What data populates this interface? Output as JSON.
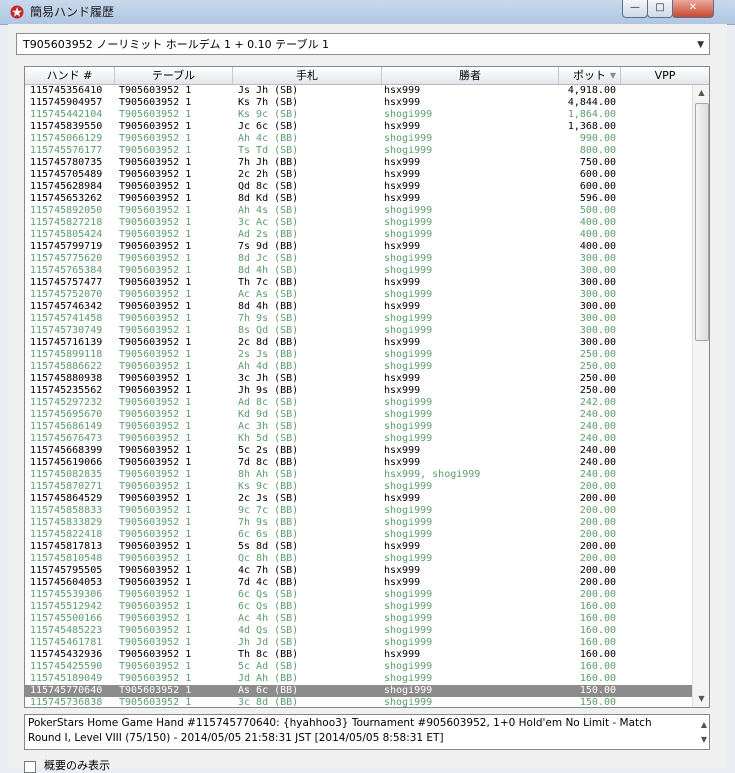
{
  "window": {
    "title": "簡易ハンド履歴"
  },
  "dropdown": {
    "value": "T905603952 ノーリミット ホールデム 1 + 0.10 テーブル 1"
  },
  "columns": [
    "ハンド #",
    "テーブル",
    "手札",
    "勝者",
    "ポット",
    "VPP"
  ],
  "rows": [
    {
      "hand": "115745356410",
      "table": "T905603952 1",
      "cards": "Js Jh (SB)",
      "winner": "hsx999",
      "pot": "4,918.00",
      "style": "black"
    },
    {
      "hand": "115745904957",
      "table": "T905603952 1",
      "cards": "Ks 7h (SB)",
      "winner": "hsx999",
      "pot": "4,844.00",
      "style": "black"
    },
    {
      "hand": "115745442104",
      "table": "T905603952 1",
      "cards": "Ks 9c (SB)",
      "winner": "shogi999",
      "pot": "1,864.00",
      "style": "green"
    },
    {
      "hand": "115745839550",
      "table": "T905603952 1",
      "cards": "Jc 6c (SB)",
      "winner": "hsx999",
      "pot": "1,368.00",
      "style": "black"
    },
    {
      "hand": "115745066129",
      "table": "T905603952 1",
      "cards": "Ah 4c (BB)",
      "winner": "shogi999",
      "pot": "990.00",
      "style": "green"
    },
    {
      "hand": "115745576177",
      "table": "T905603952 1",
      "cards": "Ts Td (SB)",
      "winner": "shogi999",
      "pot": "800.00",
      "style": "green"
    },
    {
      "hand": "115745780735",
      "table": "T905603952 1",
      "cards": "7h Jh (BB)",
      "winner": "hsx999",
      "pot": "750.00",
      "style": "black"
    },
    {
      "hand": "115745705489",
      "table": "T905603952 1",
      "cards": "2c 2h (SB)",
      "winner": "hsx999",
      "pot": "600.00",
      "style": "black"
    },
    {
      "hand": "115745628984",
      "table": "T905603952 1",
      "cards": "Qd 8c (SB)",
      "winner": "hsx999",
      "pot": "600.00",
      "style": "black"
    },
    {
      "hand": "115745653262",
      "table": "T905603952 1",
      "cards": "8d Kd (SB)",
      "winner": "hsx999",
      "pot": "596.00",
      "style": "black"
    },
    {
      "hand": "115745892050",
      "table": "T905603952 1",
      "cards": "Ah 4s (SB)",
      "winner": "shogi999",
      "pot": "500.00",
      "style": "green"
    },
    {
      "hand": "115745827218",
      "table": "T905603952 1",
      "cards": "3c Ac (SB)",
      "winner": "shogi999",
      "pot": "400.00",
      "style": "green"
    },
    {
      "hand": "115745805424",
      "table": "T905603952 1",
      "cards": "Ad 2s (BB)",
      "winner": "shogi999",
      "pot": "400.00",
      "style": "green"
    },
    {
      "hand": "115745799719",
      "table": "T905603952 1",
      "cards": "7s 9d (BB)",
      "winner": "hsx999",
      "pot": "400.00",
      "style": "black"
    },
    {
      "hand": "115745775620",
      "table": "T905603952 1",
      "cards": "8d Jc (SB)",
      "winner": "shogi999",
      "pot": "300.00",
      "style": "green"
    },
    {
      "hand": "115745765384",
      "table": "T905603952 1",
      "cards": "8d 4h (SB)",
      "winner": "shogi999",
      "pot": "300.00",
      "style": "green"
    },
    {
      "hand": "115745757477",
      "table": "T905603952 1",
      "cards": "Th 7c (BB)",
      "winner": "hsx999",
      "pot": "300.00",
      "style": "black"
    },
    {
      "hand": "115745752070",
      "table": "T905603952 1",
      "cards": "Ac As (SB)",
      "winner": "shogi999",
      "pot": "300.00",
      "style": "green"
    },
    {
      "hand": "115745746342",
      "table": "T905603952 1",
      "cards": "8d 4h (BB)",
      "winner": "hsx999",
      "pot": "300.00",
      "style": "black"
    },
    {
      "hand": "115745741458",
      "table": "T905603952 1",
      "cards": "7h 9s (SB)",
      "winner": "shogi999",
      "pot": "300.00",
      "style": "green"
    },
    {
      "hand": "115745730749",
      "table": "T905603952 1",
      "cards": "8s Qd (SB)",
      "winner": "shogi999",
      "pot": "300.00",
      "style": "green"
    },
    {
      "hand": "115745716139",
      "table": "T905603952 1",
      "cards": "2c 8d (BB)",
      "winner": "hsx999",
      "pot": "300.00",
      "style": "black"
    },
    {
      "hand": "115745899118",
      "table": "T905603952 1",
      "cards": "2s Js (BB)",
      "winner": "shogi999",
      "pot": "250.00",
      "style": "green"
    },
    {
      "hand": "115745886622",
      "table": "T905603952 1",
      "cards": "Ah 4d (BB)",
      "winner": "shogi999",
      "pot": "250.00",
      "style": "green"
    },
    {
      "hand": "115745880938",
      "table": "T905603952 1",
      "cards": "3c Jh (SB)",
      "winner": "hsx999",
      "pot": "250.00",
      "style": "black"
    },
    {
      "hand": "115745235562",
      "table": "T905603952 1",
      "cards": "Jh 9s (BB)",
      "winner": "hsx999",
      "pot": "250.00",
      "style": "black"
    },
    {
      "hand": "115745297232",
      "table": "T905603952 1",
      "cards": "Ad 8c (SB)",
      "winner": "shogi999",
      "pot": "242.00",
      "style": "green"
    },
    {
      "hand": "115745695670",
      "table": "T905603952 1",
      "cards": "Kd 9d (SB)",
      "winner": "shogi999",
      "pot": "240.00",
      "style": "green"
    },
    {
      "hand": "115745686149",
      "table": "T905603952 1",
      "cards": "Ac 3h (SB)",
      "winner": "shogi999",
      "pot": "240.00",
      "style": "green"
    },
    {
      "hand": "115745676473",
      "table": "T905603952 1",
      "cards": "Kh 5d (SB)",
      "winner": "shogi999",
      "pot": "240.00",
      "style": "green"
    },
    {
      "hand": "115745668399",
      "table": "T905603952 1",
      "cards": "5c 2s (BB)",
      "winner": "hsx999",
      "pot": "240.00",
      "style": "black"
    },
    {
      "hand": "115745619066",
      "table": "T905603952 1",
      "cards": "7d 8c (BB)",
      "winner": "hsx999",
      "pot": "240.00",
      "style": "black"
    },
    {
      "hand": "115745082835",
      "table": "T905603952 1",
      "cards": "8h Ah (SB)",
      "winner": "hsx999, shogi999",
      "pot": "240.00",
      "style": "green"
    },
    {
      "hand": "115745870271",
      "table": "T905603952 1",
      "cards": "Ks 9c (BB)",
      "winner": "shogi999",
      "pot": "200.00",
      "style": "green"
    },
    {
      "hand": "115745864529",
      "table": "T905603952 1",
      "cards": "2c Js (SB)",
      "winner": "hsx999",
      "pot": "200.00",
      "style": "black"
    },
    {
      "hand": "115745858833",
      "table": "T905603952 1",
      "cards": "9c 7c (BB)",
      "winner": "shogi999",
      "pot": "200.00",
      "style": "green"
    },
    {
      "hand": "115745833829",
      "table": "T905603952 1",
      "cards": "7h 9s (BB)",
      "winner": "shogi999",
      "pot": "200.00",
      "style": "green"
    },
    {
      "hand": "115745822418",
      "table": "T905603952 1",
      "cards": "6c 6s (BB)",
      "winner": "shogi999",
      "pot": "200.00",
      "style": "green"
    },
    {
      "hand": "115745817813",
      "table": "T905603952 1",
      "cards": "5s 8d (SB)",
      "winner": "hsx999",
      "pot": "200.00",
      "style": "black"
    },
    {
      "hand": "115745810548",
      "table": "T905603952 1",
      "cards": "Qc 8h (BB)",
      "winner": "shogi999",
      "pot": "200.00",
      "style": "green"
    },
    {
      "hand": "115745795505",
      "table": "T905603952 1",
      "cards": "4c 7h (SB)",
      "winner": "hsx999",
      "pot": "200.00",
      "style": "black"
    },
    {
      "hand": "115745604053",
      "table": "T905603952 1",
      "cards": "7d 4c (BB)",
      "winner": "hsx999",
      "pot": "200.00",
      "style": "black"
    },
    {
      "hand": "115745539306",
      "table": "T905603952 1",
      "cards": "6c Qs (SB)",
      "winner": "shogi999",
      "pot": "200.00",
      "style": "green"
    },
    {
      "hand": "115745512942",
      "table": "T905603952 1",
      "cards": "6c Qs (BB)",
      "winner": "shogi999",
      "pot": "160.00",
      "style": "green"
    },
    {
      "hand": "115745500166",
      "table": "T905603952 1",
      "cards": "Ac 4h (SB)",
      "winner": "shogi999",
      "pot": "160.00",
      "style": "green"
    },
    {
      "hand": "115745485223",
      "table": "T905603952 1",
      "cards": "4d Qs (SB)",
      "winner": "shogi999",
      "pot": "160.00",
      "style": "green"
    },
    {
      "hand": "115745461781",
      "table": "T905603952 1",
      "cards": "Jh Jd (SB)",
      "winner": "shogi999",
      "pot": "160.00",
      "style": "green"
    },
    {
      "hand": "115745432936",
      "table": "T905603952 1",
      "cards": "Th 8c (BB)",
      "winner": "hsx999",
      "pot": "160.00",
      "style": "black"
    },
    {
      "hand": "115745425590",
      "table": "T905603952 1",
      "cards": "5c Ad (SB)",
      "winner": "shogi999",
      "pot": "160.00",
      "style": "green"
    },
    {
      "hand": "115745189049",
      "table": "T905603952 1",
      "cards": "Jd Ah (BB)",
      "winner": "shogi999",
      "pot": "160.00",
      "style": "green"
    },
    {
      "hand": "115745770640",
      "table": "T905603952 1",
      "cards": "As 6c (BB)",
      "winner": "shogi999",
      "pot": "150.00",
      "style": "selected"
    },
    {
      "hand": "115745736838",
      "table": "T905603952 1",
      "cards": "3c 8d (BB)",
      "winner": "shogi999",
      "pot": "150.00",
      "style": "green"
    }
  ],
  "detail": {
    "text": "PokerStars Home Game Hand #115745770640: {hyahhoo3} Tournament #905603952, 1+0 Hold'em No Limit - Match Round I, Level VIII (75/150) - 2014/05/05 21:58:31 JST [2014/05/05 8:58:31 ET]"
  },
  "checkbox": {
    "label": "概要のみ表示"
  },
  "icons": {
    "title": "pokerstars-logo-icon",
    "dropdown": "chevron-down-icon"
  },
  "colors": {
    "winner_row": "#000000",
    "other_row": "#5b9d6b",
    "selected_row": "#8c8c8c"
  }
}
